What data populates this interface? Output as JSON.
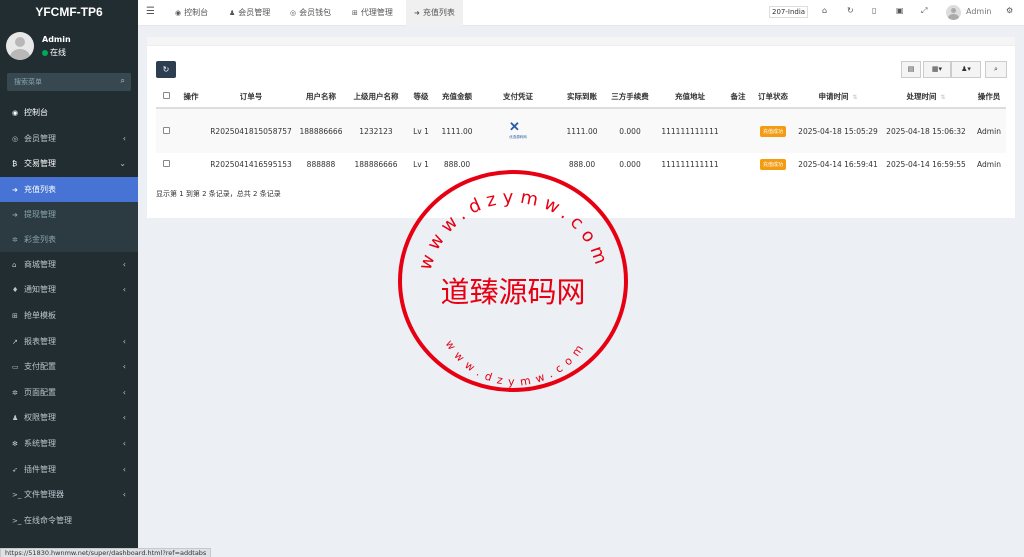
{
  "app": {
    "logo": "YFCMF-TP6"
  },
  "user": {
    "name": "Admin",
    "status": "在线"
  },
  "search": {
    "placeholder": "搜索菜单"
  },
  "menu": [
    {
      "label": "控制台",
      "icon": "dashboard-icon",
      "glyph": "◉",
      "arrow": ""
    },
    {
      "label": "会员管理",
      "icon": "user-circle-icon",
      "glyph": "◎",
      "arrow": "‹"
    },
    {
      "label": "交易管理",
      "icon": "bitcoin-icon",
      "glyph": "₿",
      "arrow": "⌄"
    },
    {
      "label": "充值列表",
      "icon": "sign-in-icon",
      "glyph": "➜",
      "arrow": ""
    },
    {
      "label": "提现管理",
      "icon": "sign-out-icon",
      "glyph": "➜",
      "arrow": ""
    },
    {
      "label": "彩金列表",
      "icon": "gear-icon",
      "glyph": "✲",
      "arrow": ""
    },
    {
      "label": "商城管理",
      "icon": "home-icon",
      "glyph": "⌂",
      "arrow": "‹"
    },
    {
      "label": "通知管理",
      "icon": "bell-icon",
      "glyph": "♦",
      "arrow": "‹"
    },
    {
      "label": "抢单模板",
      "icon": "sitemap-icon",
      "glyph": "⊞",
      "arrow": ""
    },
    {
      "label": "报表管理",
      "icon": "line-chart-icon",
      "glyph": "↗",
      "arrow": "‹"
    },
    {
      "label": "支付配置",
      "icon": "credit-card-icon",
      "glyph": "▭",
      "arrow": "‹"
    },
    {
      "label": "页面配置",
      "icon": "cog-icon",
      "glyph": "✲",
      "arrow": "‹"
    },
    {
      "label": "权限管理",
      "icon": "user-group-icon",
      "glyph": "♟",
      "arrow": "‹"
    },
    {
      "label": "系统管理",
      "icon": "cogs-icon",
      "glyph": "✻",
      "arrow": "‹"
    },
    {
      "label": "插件管理",
      "icon": "rocket-icon",
      "glyph": "➶",
      "arrow": "‹"
    },
    {
      "label": "文件管理器",
      "icon": "terminal-icon",
      "glyph": ">_",
      "arrow": "‹"
    },
    {
      "label": "在线命令管理",
      "icon": "terminal-icon",
      "glyph": ">_",
      "arrow": ""
    }
  ],
  "header": {
    "tabs": [
      {
        "label": "控制台",
        "icon": "dashboard-icon",
        "glyph": "◉"
      },
      {
        "label": "会员管理",
        "icon": "user-icon",
        "glyph": "♟"
      },
      {
        "label": "会员钱包",
        "icon": "wallet-icon",
        "glyph": "◎"
      },
      {
        "label": "代理管理",
        "icon": "sitemap-icon",
        "glyph": "⊞"
      },
      {
        "label": "充值列表",
        "icon": "sign-in-icon",
        "glyph": "➜"
      }
    ],
    "lang": "207-India",
    "admin": "Admin"
  },
  "table": {
    "headers": [
      "操作",
      "订单号",
      "用户名称",
      "上级用户名称",
      "等级",
      "充值金额",
      "支付凭证",
      "实际到账",
      "三方手续费",
      "充值地址",
      "备注",
      "订单状态",
      "申请时间",
      "处理时间",
      "操作员"
    ],
    "rows": [
      {
        "order": "R2025041815058757",
        "user": "188886666",
        "parent": "1232123",
        "level": "Lv 1",
        "amount": "1111.00",
        "voucher_caption": "优选源码网",
        "actual": "1111.00",
        "fee": "0.000",
        "address": "111111111111",
        "remark": "",
        "status": "充值成功",
        "applied": "2025-04-18 15:05:29",
        "processed": "2025-04-18 15:06:32",
        "operator": "Admin"
      },
      {
        "order": "R2025041416595153",
        "user": "888888",
        "parent": "188886666",
        "level": "Lv 1",
        "amount": "888.00",
        "voucher_caption": "",
        "actual": "888.00",
        "fee": "0.000",
        "address": "111111111111",
        "remark": "",
        "status": "充值成功",
        "applied": "2025-04-14 16:59:41",
        "processed": "2025-04-14 16:59:55",
        "operator": "Admin"
      }
    ],
    "summary": "显示第 1 到第 2 条记录，总共 2 条记录"
  },
  "watermark": {
    "top_arc": "www.dzymw.com",
    "bottom_arc": "www.dzymw.com",
    "center": "道臻源码网",
    "color": "#e60012"
  },
  "statusbar": {
    "url": "https://51830.hwnmw.net/super/dashboard.html?ref=addtabs"
  },
  "colors": {
    "sidebar": "#222d32",
    "active": "#4673d4",
    "badge": "#f39c12"
  }
}
